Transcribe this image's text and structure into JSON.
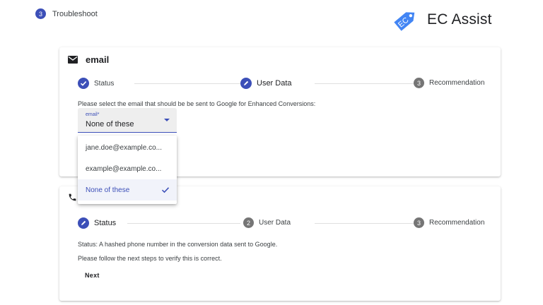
{
  "top_step": {
    "number": "3",
    "label": "Troubleshoot"
  },
  "brand": {
    "logo_text": "EC",
    "name": "EC Assist"
  },
  "colors": {
    "accent": "#3c4fb8",
    "inactive": "#757575",
    "logo": "#4285f4"
  },
  "email_card": {
    "title": "email",
    "icon": "envelope-icon",
    "steps": [
      {
        "state": "done",
        "label": "Status"
      },
      {
        "state": "edit",
        "label": "User Data"
      },
      {
        "number": "3",
        "label": "Recommendation"
      }
    ],
    "prompt": "Please select the email that should be be sent to Google for Enhanced Conversions:",
    "select": {
      "label": "email*",
      "value": "None of these"
    }
  },
  "dropdown": {
    "options": [
      {
        "label": "jane.doe@example.co...",
        "selected": false
      },
      {
        "label": "example@example.co...",
        "selected": false
      },
      {
        "label": "None of these",
        "selected": true
      }
    ]
  },
  "phone_card": {
    "icon": "phone-icon",
    "steps": [
      {
        "state": "edit",
        "label": "Status"
      },
      {
        "number": "2",
        "label": "User Data"
      },
      {
        "number": "3",
        "label": "Recommendation"
      }
    ],
    "status_text": "Status: A hashed phone number in the conversion data sent to Google.",
    "follow_text": "Please follow the next steps to verify this is correct.",
    "next_label": "Next"
  }
}
